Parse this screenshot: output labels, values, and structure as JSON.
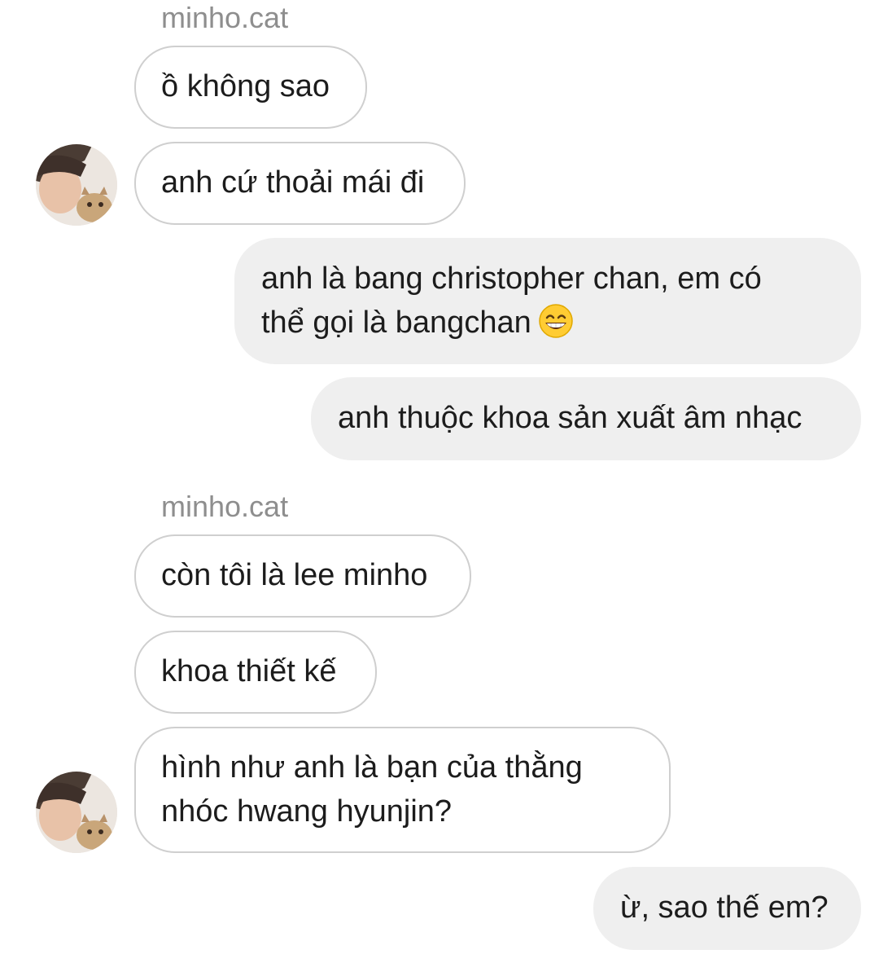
{
  "conversation": {
    "sender_name": "minho.cat",
    "sender_name_2": "minho.cat",
    "messages": [
      {
        "dir": "in",
        "text": "ồ không sao"
      },
      {
        "dir": "in",
        "text": "anh cứ thoải mái đi"
      },
      {
        "dir": "out",
        "line1": "anh là bang christopher chan, em có",
        "line2": "thể gọi là bangchan",
        "emoji": "grinning-face-with-smiling-eyes-icon"
      },
      {
        "dir": "out",
        "text": "anh thuộc khoa sản xuất âm nhạc"
      },
      {
        "dir": "in",
        "text": "còn tôi là lee minho"
      },
      {
        "dir": "in",
        "text": "khoa thiết kế"
      },
      {
        "dir": "in",
        "line1": "hình như anh là bạn của thằng",
        "line2": "nhóc hwang hyunjin?"
      },
      {
        "dir": "out",
        "text": "ừ, sao thế em?"
      }
    ]
  },
  "colors": {
    "incoming_border": "#cfcfcf",
    "outgoing_bg": "#efefef",
    "sender_name": "#8e8e8e",
    "text": "#1c1c1c"
  }
}
